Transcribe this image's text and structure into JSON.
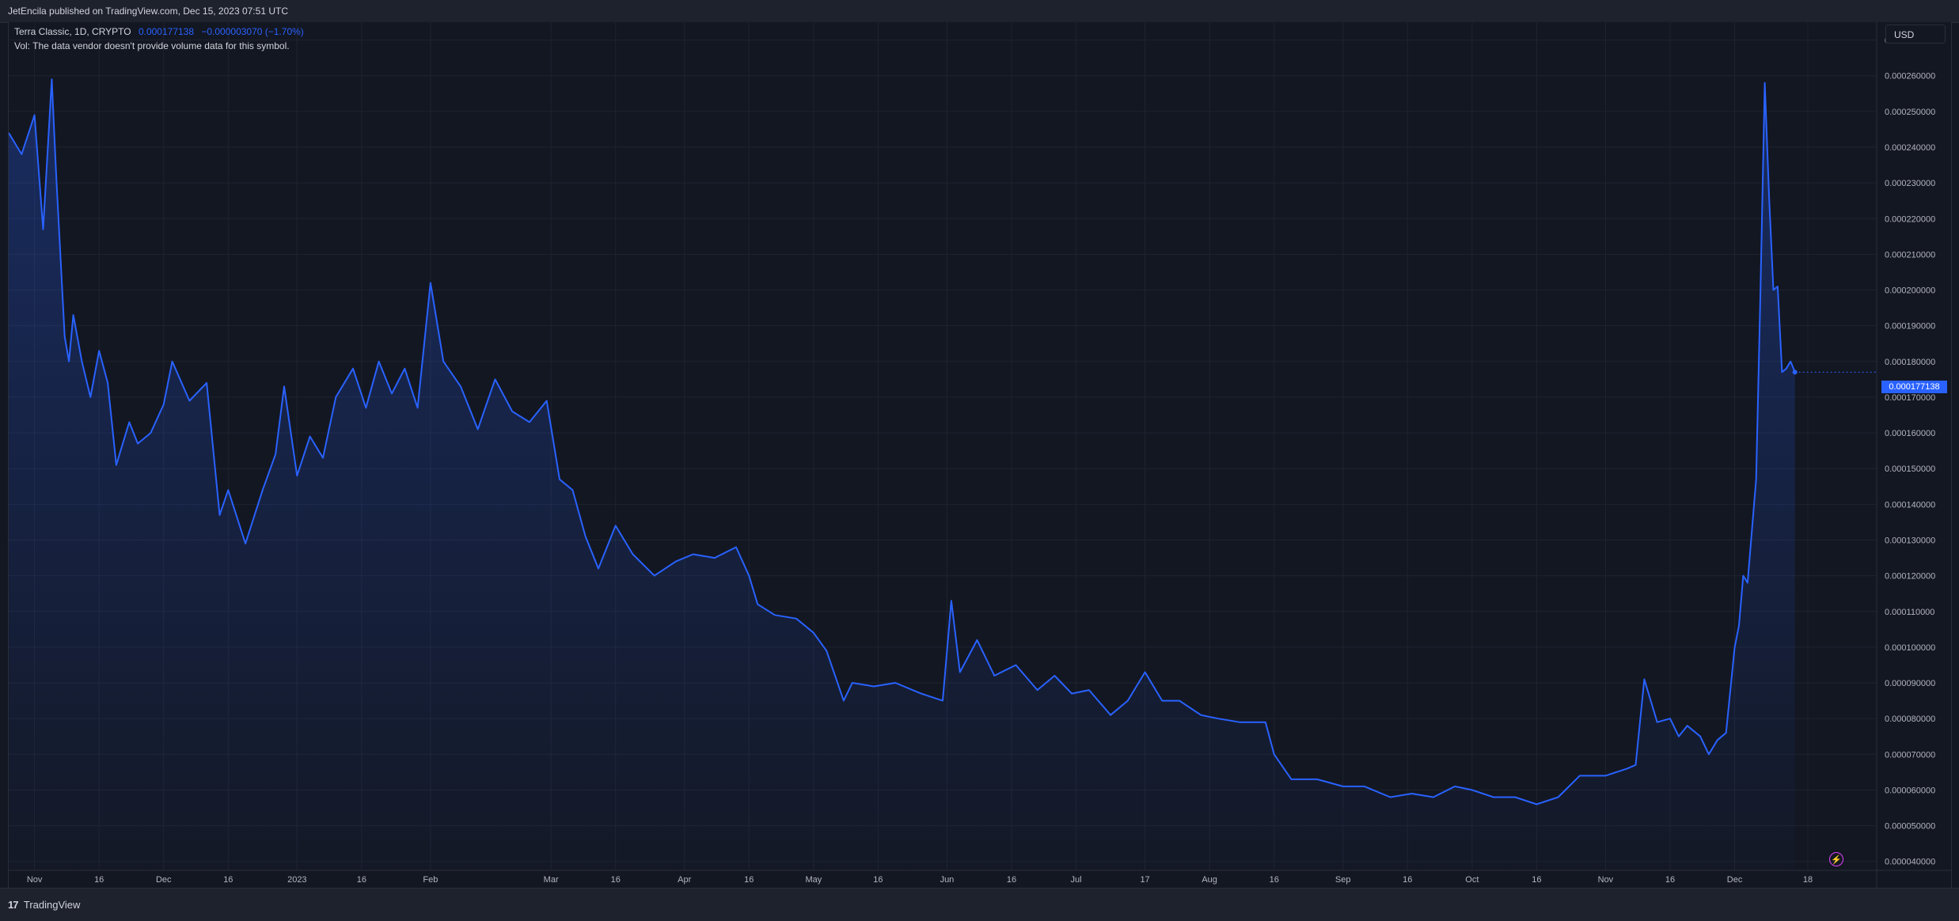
{
  "header": {
    "published_text": "JetEncila published on TradingView.com, Dec 15, 2023 07:51 UTC"
  },
  "legend": {
    "symbol": "Terra Classic, 1D, CRYPTO",
    "last_value": "0.000177138",
    "change": "−0.000003070 (−1.70%)",
    "volume_note": "Vol: The data vendor doesn't provide volume data for this symbol."
  },
  "price_scale": {
    "currency_label": "USD",
    "current_price_label": "0.000177138"
  },
  "footer": {
    "logo_mark": "17",
    "logo_text": "TradingView"
  },
  "icons": {
    "bolt": "lightning-bolt-icon"
  },
  "colors": {
    "background": "#131722",
    "line": "#2962ff",
    "grid": "#1f2330",
    "text": "#d1d4dc",
    "accent": "#e040fb"
  },
  "chart_data": {
    "type": "area",
    "title": "Terra Classic, 1D, CRYPTO",
    "x_tick_labels": [
      "Nov",
      "16",
      "Dec",
      "16",
      "2023",
      "16",
      "Feb",
      "Mar",
      "16",
      "Apr",
      "16",
      "May",
      "16",
      "Jun",
      "16",
      "Jul",
      "17",
      "Aug",
      "16",
      "Sep",
      "16",
      "Oct",
      "16",
      "Nov",
      "16",
      "Dec",
      "18"
    ],
    "y_tick_labels": [
      "0.000270000",
      "0.000260000",
      "0.000250000",
      "0.000240000",
      "0.000230000",
      "0.000220000",
      "0.000210000",
      "0.000200000",
      "0.000190000",
      "0.000180000",
      "0.000170000",
      "0.000160000",
      "0.000150000",
      "0.000140000",
      "0.000130000",
      "0.000120000",
      "0.000110000",
      "0.000100000",
      "0.000090000",
      "0.000080000",
      "0.000070000",
      "0.000060000",
      "0.000050000",
      "0.000040000"
    ],
    "ylim": [
      3.75e-05,
      0.000275
    ],
    "xlim": [
      "2022-10-26",
      "2024-01-03"
    ],
    "grid": true,
    "series": [
      {
        "x": [
          "2022-10-26",
          "2022-10-29",
          "2022-11-01",
          "2022-11-03",
          "2022-11-05",
          "2022-11-06",
          "2022-11-08",
          "2022-11-09",
          "2022-11-10",
          "2022-11-12",
          "2022-11-14",
          "2022-11-16",
          "2022-11-18",
          "2022-11-20",
          "2022-11-23",
          "2022-11-25",
          "2022-11-28",
          "2022-12-01",
          "2022-12-03",
          "2022-12-07",
          "2022-12-11",
          "2022-12-14",
          "2022-12-16",
          "2022-12-20",
          "2022-12-24",
          "2022-12-27",
          "2022-12-29",
          "2023-01-01",
          "2023-01-04",
          "2023-01-07",
          "2023-01-10",
          "2023-01-14",
          "2023-01-17",
          "2023-01-20",
          "2023-01-23",
          "2023-01-26",
          "2023-01-29",
          "2023-02-01",
          "2023-02-04",
          "2023-02-08",
          "2023-02-12",
          "2023-02-16",
          "2023-02-20",
          "2023-02-24",
          "2023-02-28",
          "2023-03-03",
          "2023-03-06",
          "2023-03-09",
          "2023-03-12",
          "2023-03-16",
          "2023-03-20",
          "2023-03-25",
          "2023-03-30",
          "2023-04-03",
          "2023-04-08",
          "2023-04-13",
          "2023-04-16",
          "2023-04-18",
          "2023-04-22",
          "2023-04-27",
          "2023-05-01",
          "2023-05-04",
          "2023-05-08",
          "2023-05-10",
          "2023-05-15",
          "2023-05-20",
          "2023-05-26",
          "2023-05-31",
          "2023-06-02",
          "2023-06-04",
          "2023-06-08",
          "2023-06-12",
          "2023-06-17",
          "2023-06-22",
          "2023-06-26",
          "2023-06-30",
          "2023-07-04",
          "2023-07-09",
          "2023-07-13",
          "2023-07-17",
          "2023-07-21",
          "2023-07-25",
          "2023-07-30",
          "2023-08-03",
          "2023-08-08",
          "2023-08-14",
          "2023-08-16",
          "2023-08-20",
          "2023-08-26",
          "2023-09-01",
          "2023-09-06",
          "2023-09-12",
          "2023-09-17",
          "2023-09-22",
          "2023-09-27",
          "2023-10-01",
          "2023-10-06",
          "2023-10-11",
          "2023-10-16",
          "2023-10-21",
          "2023-10-26",
          "2023-11-01",
          "2023-11-06",
          "2023-11-08",
          "2023-11-10",
          "2023-11-13",
          "2023-11-16",
          "2023-11-18",
          "2023-11-20",
          "2023-11-23",
          "2023-11-25",
          "2023-11-27",
          "2023-11-29",
          "2023-12-01",
          "2023-12-02",
          "2023-12-03",
          "2023-12-04",
          "2023-12-06",
          "2023-12-07",
          "2023-12-08",
          "2023-12-09",
          "2023-12-10",
          "2023-12-11",
          "2023-12-12",
          "2023-12-13",
          "2023-12-14",
          "2023-12-15"
        ],
        "values": [
          0.000244,
          0.000238,
          0.000249,
          0.000217,
          0.000259,
          0.000233,
          0.000187,
          0.00018,
          0.000193,
          0.00018,
          0.00017,
          0.000183,
          0.000174,
          0.000151,
          0.000163,
          0.000157,
          0.00016,
          0.000168,
          0.00018,
          0.000169,
          0.000174,
          0.000137,
          0.000144,
          0.000129,
          0.000144,
          0.000154,
          0.000173,
          0.000148,
          0.000159,
          0.000153,
          0.00017,
          0.000178,
          0.000167,
          0.00018,
          0.000171,
          0.000178,
          0.000167,
          0.000202,
          0.00018,
          0.000173,
          0.000161,
          0.000175,
          0.000166,
          0.000163,
          0.000169,
          0.000147,
          0.000144,
          0.000131,
          0.000122,
          0.000134,
          0.000126,
          0.00012,
          0.000124,
          0.000126,
          0.000125,
          0.000128,
          0.00012,
          0.000112,
          0.000109,
          0.000108,
          0.000104,
          9.9e-05,
          8.5e-05,
          9e-05,
          8.9e-05,
          9e-05,
          8.7e-05,
          8.5e-05,
          0.000113,
          9.3e-05,
          0.000102,
          9.2e-05,
          9.5e-05,
          8.8e-05,
          9.2e-05,
          8.7e-05,
          8.8e-05,
          8.1e-05,
          8.5e-05,
          9.3e-05,
          8.5e-05,
          8.5e-05,
          8.1e-05,
          8e-05,
          7.9e-05,
          7.9e-05,
          7e-05,
          6.3e-05,
          6.3e-05,
          6.1e-05,
          6.1e-05,
          5.8e-05,
          5.9e-05,
          5.8e-05,
          6.1e-05,
          6e-05,
          5.8e-05,
          5.8e-05,
          5.6e-05,
          5.8e-05,
          6.4e-05,
          6.4e-05,
          6.6e-05,
          6.7e-05,
          9.1e-05,
          7.9e-05,
          8e-05,
          7.5e-05,
          7.8e-05,
          7.5e-05,
          7e-05,
          7.4e-05,
          7.6e-05,
          0.0001,
          0.000106,
          0.00012,
          0.000118,
          0.000147,
          0.0002,
          0.000258,
          0.000226,
          0.0002,
          0.000201,
          0.000177,
          0.000178,
          0.00018,
          0.000177
        ]
      }
    ]
  }
}
